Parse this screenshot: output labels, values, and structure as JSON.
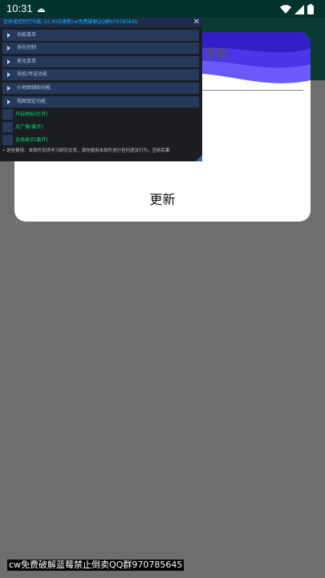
{
  "status_bar": {
    "time": "10:31",
    "icons": [
      "android-debug-icon",
      "wifi-icon",
      "signal-icon",
      "battery-icon"
    ]
  },
  "dialog": {
    "title": "更新",
    "button_label": "更新"
  },
  "menu": {
    "header": "豆桥遥控烈行功能-10.30日更新cw免费破解QQ群970785645",
    "items": [
      "功能菜单",
      "多队控制",
      "美化菜单",
      "导航/传送功能",
      "小地图辅助功能",
      "视图锁定功能"
    ],
    "toggles": [
      "开启地标(打开)",
      "瓜广角(离开)",
      "全局显示(离开)"
    ],
    "note": "• 这份费用：本软件仅供学习研究交流，请勿使用本软件进行任何违法行为，否则后果"
  },
  "watermark": "cw免费破解蓝莓禁止倒卖QQ群970785645"
}
